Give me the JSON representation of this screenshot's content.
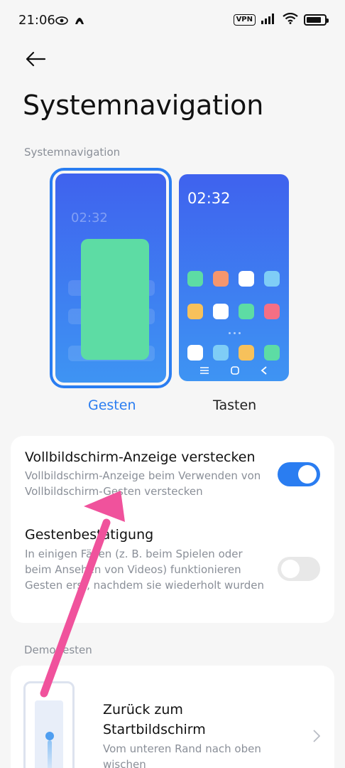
{
  "status_bar": {
    "time": "21:06",
    "vpn": "VPN",
    "battery_level": 0.85,
    "icons": [
      "eye-icon",
      "arc-icon",
      "signal-icon",
      "wifi-icon",
      "battery-icon"
    ]
  },
  "header": {
    "title": "Systemnavigation"
  },
  "navigation_section": {
    "label": "Systemnavigation",
    "options": [
      {
        "label": "Gesten",
        "selected": true
      },
      {
        "label": "Tasten",
        "selected": false
      }
    ],
    "keys_preview_time": "02:32",
    "gestures_preview_time": "02:32"
  },
  "settings": {
    "rows": [
      {
        "title": "Vollbildschirm-Anzeige verstecken",
        "description": "Vollbildschirm-Anzeige beim Verwenden von Vollbildschirm-Gesten verstecken",
        "enabled": true
      },
      {
        "title": "Gestenbestätigung",
        "description": "In einigen Fällen (z. B. beim Spielen oder beim Ansehen von Videos) funktionieren Gesten erst, nachdem sie wiederholt wurden",
        "enabled": false
      }
    ]
  },
  "demo_section": {
    "label": "Demogesten",
    "item": {
      "title": "Zurück zum Startbildschirm",
      "description": "Vom unteren Rand nach oben wischen"
    }
  },
  "colors": {
    "accent": "#2a7df1",
    "annotation": "#f0529c",
    "app_green": "#5ddca4",
    "app_orange": "#f5966e",
    "app_lightblue": "#7fcdf6",
    "app_yellow": "#f7c15b",
    "app_red": "#f56f84"
  }
}
